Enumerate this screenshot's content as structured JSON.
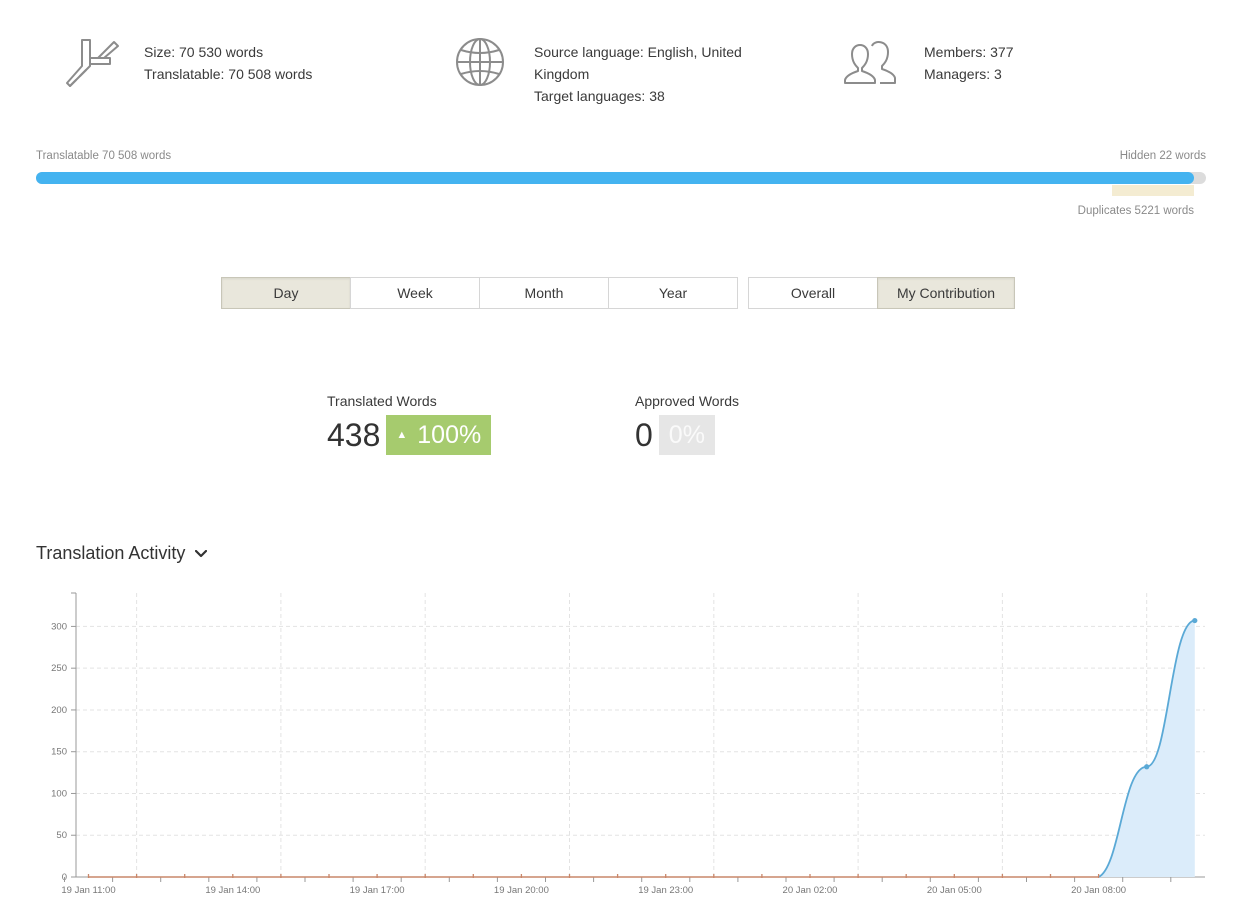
{
  "summary": {
    "size": {
      "icon": "calipers-icon",
      "line1": "Size: 70 530 words",
      "line2": "Translatable: 70 508 words"
    },
    "languages": {
      "icon": "globe-icon",
      "line1": "Source language: English, United",
      "line2": "Kingdom",
      "line3": "Target languages: 38"
    },
    "members": {
      "icon": "users-icon",
      "line1": "Members: 377",
      "line2": "Managers: 3"
    }
  },
  "progress": {
    "translatable_label": "Translatable 70 508 words",
    "hidden_label": "Hidden 22 words",
    "duplicates_label": "Duplicates 5221 words",
    "translatable_words": 70508,
    "hidden_words": 22,
    "duplicate_words": 5221,
    "colors": {
      "fill": "#44b3f0",
      "track": "#dcdcdc",
      "duplicates": "#f4ecd2"
    }
  },
  "period_tabs": {
    "items": [
      "Day",
      "Week",
      "Month",
      "Year"
    ],
    "selected": "Day"
  },
  "scope_tabs": {
    "items": [
      "Overall",
      "My Contribution"
    ],
    "selected": "My Contribution"
  },
  "stats": {
    "translated": {
      "label": "Translated Words",
      "value": "438",
      "change": "100%",
      "trend_icon": "triangle-up-icon",
      "color": "#a6cb6e"
    },
    "approved": {
      "label": "Approved Words",
      "value": "0",
      "change": "0%",
      "color": "#e6e6e6"
    }
  },
  "section": {
    "title": "Translation Activity",
    "toggle_icon": "chevron-down-icon"
  },
  "chart_data": {
    "type": "area",
    "title": "",
    "xlabel": "",
    "ylabel": "",
    "x_tick_labels": [
      "19 Jan 11:00",
      "19 Jan 14:00",
      "19 Jan 17:00",
      "19 Jan 20:00",
      "19 Jan 23:00",
      "20 Jan 02:00",
      "20 Jan 05:00",
      "20 Jan 08:00"
    ],
    "x": [
      "19 Jan 11:00",
      "19 Jan 12:00",
      "19 Jan 13:00",
      "19 Jan 14:00",
      "19 Jan 15:00",
      "19 Jan 16:00",
      "19 Jan 17:00",
      "19 Jan 18:00",
      "19 Jan 19:00",
      "19 Jan 20:00",
      "19 Jan 21:00",
      "19 Jan 22:00",
      "19 Jan 23:00",
      "20 Jan 00:00",
      "20 Jan 01:00",
      "20 Jan 02:00",
      "20 Jan 03:00",
      "20 Jan 04:00",
      "20 Jan 05:00",
      "20 Jan 06:00",
      "20 Jan 07:00",
      "20 Jan 08:00",
      "20 Jan 09:00",
      "20 Jan 10:00"
    ],
    "series": [
      {
        "values": [
          0,
          0,
          0,
          0,
          0,
          0,
          0,
          0,
          0,
          0,
          0,
          0,
          0,
          0,
          0,
          0,
          0,
          0,
          0,
          0,
          0,
          0,
          132,
          307
        ]
      }
    ],
    "y_ticks": [
      0,
      50,
      100,
      150,
      200,
      250,
      300
    ],
    "ylim": [
      0,
      340
    ],
    "grid": true,
    "colors": {
      "line": "#5aa9d6",
      "area": "#dbecfa",
      "baseline_markers": "#c9876a",
      "grid": "#e3e3e3"
    }
  }
}
